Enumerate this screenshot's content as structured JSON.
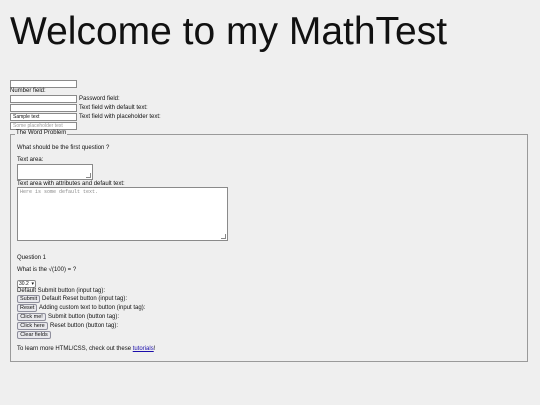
{
  "page": {
    "heading": "Welcome to my MathTest"
  },
  "form": {
    "number_label": "Number field:",
    "password_label": "Password field:",
    "text_default_label": "Text field with default text:",
    "text_default_value": "Sample text",
    "text_placeholder_label": "Text field with placeholder text:",
    "text_placeholder": "Some placeholder text"
  },
  "word_problem": {
    "legend": "The Word Problem",
    "first_question": "What should be the first question ?",
    "text_area_label": "Text area:",
    "text_area_attr_label": "Text area with attributes and default text:",
    "text_area_default": "Here is some default text.",
    "question_heading": "Question 1",
    "question_text": "What is the √(100) = ?",
    "select_value": "30.2",
    "default_submit_label": "Default Submit button (input tag):",
    "submit_button": "Submit",
    "default_reset_label": "Default Reset button (input tag):",
    "reset_button": "Reset",
    "custom_reset_label": "Adding custom text to button (input tag):",
    "click_me_button": "Click me!",
    "submit_button_tag_label": "Submit button (button tag):",
    "click_here_button": "Click here",
    "reset_button_tag_label": "Reset button (button tag):",
    "clear_fields_button": "Clear fields",
    "learn_more_prefix": "To learn more HTML/CSS, check out these ",
    "learn_more_link": "tutorials",
    "learn_more_suffix": "!"
  }
}
